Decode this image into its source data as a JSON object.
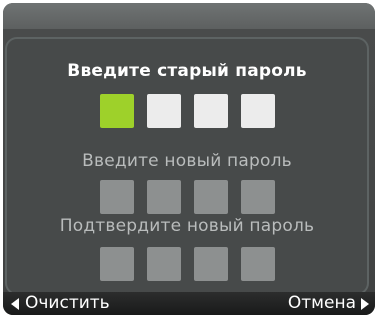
{
  "dialog": {
    "old_password_label": "Введите старый пароль",
    "new_password_label": "Введите новый пароль",
    "confirm_password_label": "Подтвердите новый пароль",
    "old_password_boxes": 4,
    "new_password_boxes": 4,
    "confirm_password_boxes": 4,
    "focused_box_index": 0
  },
  "softkeys": {
    "left_label": "Очистить",
    "right_label": "Отмена",
    "left_icon": "triangle-left-icon",
    "right_icon": "triangle-right-icon"
  },
  "colors": {
    "focus": "#9ed12a",
    "active_box": "#ececec",
    "inactive_box": "#8d9090",
    "background": "#474a4a"
  }
}
